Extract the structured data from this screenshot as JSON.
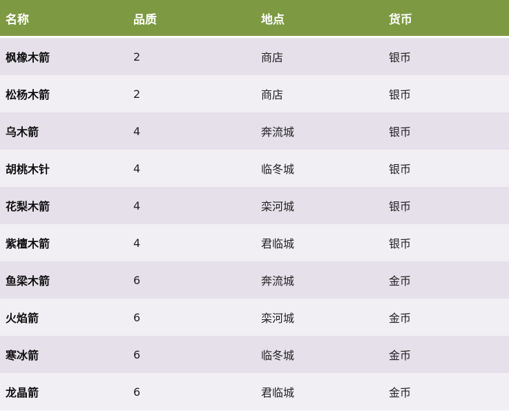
{
  "table": {
    "headers": [
      "名称",
      "品质",
      "地点",
      "货币"
    ],
    "rows": [
      {
        "name": "枫橡木箭",
        "quality": "2",
        "location": "商店",
        "currency": "银币"
      },
      {
        "name": "松杨木箭",
        "quality": "2",
        "location": "商店",
        "currency": "银币"
      },
      {
        "name": "乌木箭",
        "quality": "4",
        "location": "奔流城",
        "currency": "银币"
      },
      {
        "name": "胡桃木针",
        "quality": "4",
        "location": "临冬城",
        "currency": "银币"
      },
      {
        "name": "花梨木箭",
        "quality": "4",
        "location": "栾河城",
        "currency": "银币"
      },
      {
        "name": "紫檀木箭",
        "quality": "4",
        "location": "君临城",
        "currency": "银币"
      },
      {
        "name": "鱼梁木箭",
        "quality": "6",
        "location": "奔流城",
        "currency": "金币"
      },
      {
        "name": "火焰箭",
        "quality": "6",
        "location": "栾河城",
        "currency": "金币"
      },
      {
        "name": "寒冰箭",
        "quality": "6",
        "location": "临冬城",
        "currency": "金币"
      },
      {
        "name": "龙晶箭",
        "quality": "6",
        "location": "君临城",
        "currency": "金币"
      }
    ]
  },
  "colors": {
    "header_bg": "#7d9a43",
    "row_odd": "#e5e0ea",
    "row_even": "#f1eef4"
  }
}
